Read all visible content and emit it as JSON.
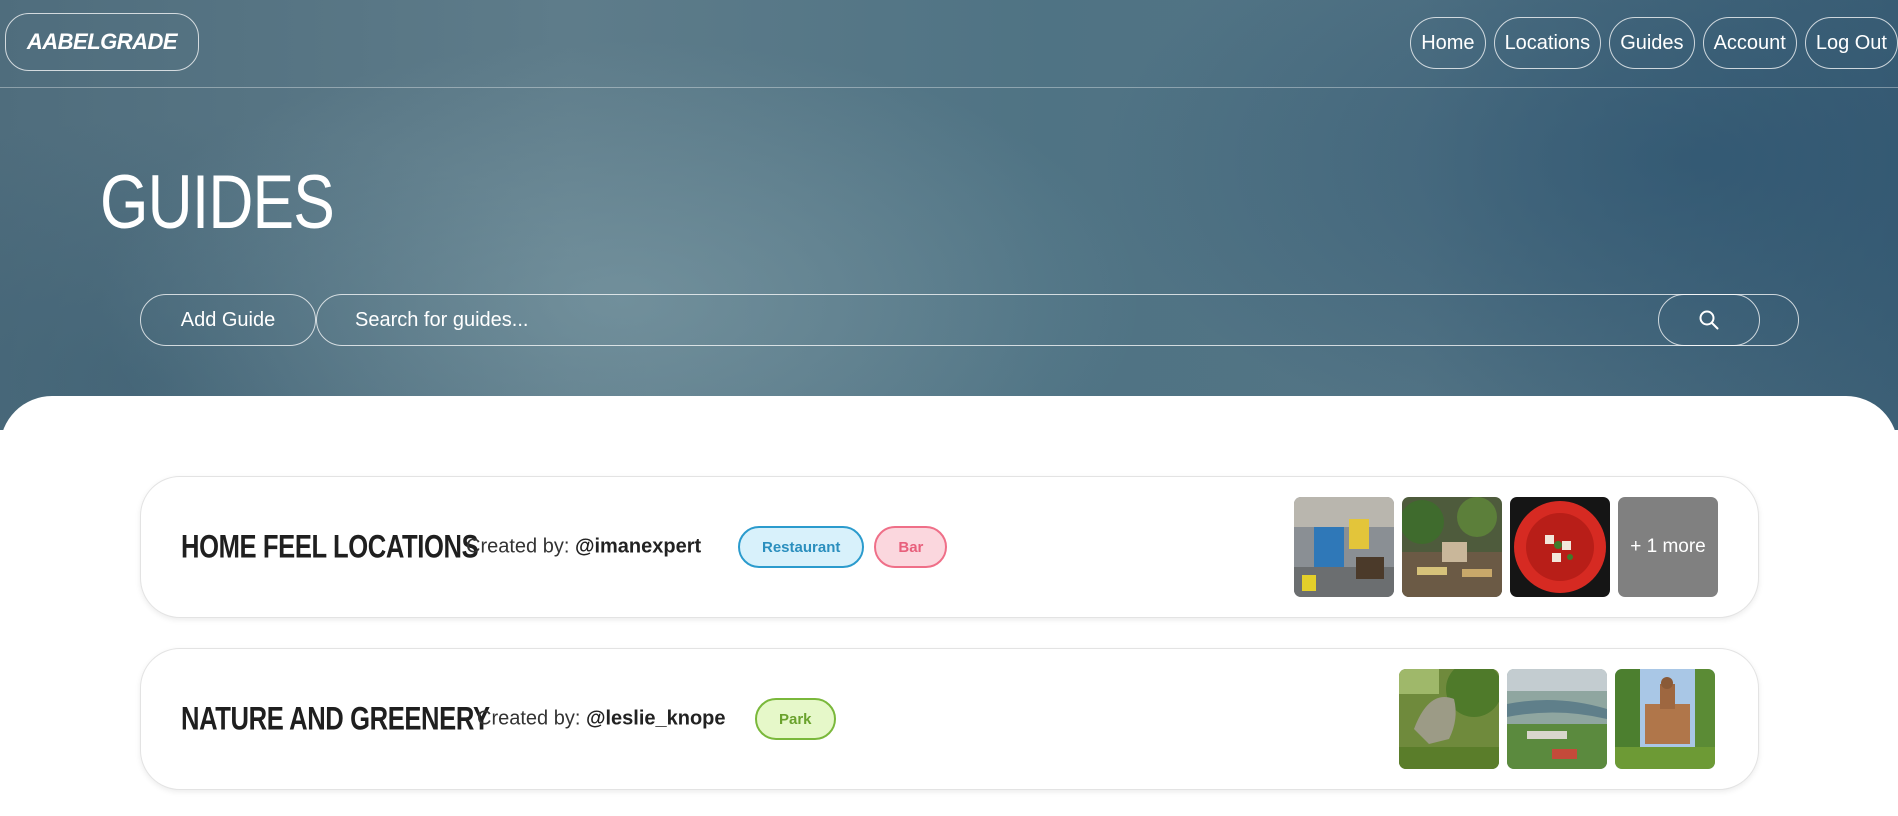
{
  "app": {
    "logo": "AABELGRADE"
  },
  "nav": {
    "items": [
      "Home",
      "Locations",
      "Guides",
      "Account",
      "Log Out"
    ]
  },
  "page": {
    "title": "GUIDES"
  },
  "toolbar": {
    "add_guide_label": "Add Guide",
    "search_placeholder": "Search for guides..."
  },
  "guides": [
    {
      "title": "HOME FEEL LOCATIONS",
      "created_by_label": "Created by:",
      "author": "@imanexpert",
      "tags": [
        {
          "label": "Restaurant",
          "bg": "#d8f1fb",
          "border": "#2b9bcd",
          "color": "#2b8fbe"
        },
        {
          "label": "Bar",
          "bg": "#fbd7de",
          "border": "#ef6f88",
          "color": "#e8607c"
        }
      ],
      "thumbnails": [
        "restaurant-interior-photo",
        "terrace-dining-photo",
        "red-dish-photo"
      ],
      "more_label": "+ 1 more"
    },
    {
      "title": "NATURE AND GREENERY",
      "created_by_label": "Created by:",
      "author": "@leslie_knope",
      "tags": [
        {
          "label": "Park",
          "bg": "#e6f8c9",
          "border": "#7ab83b",
          "color": "#6aa22c"
        }
      ],
      "thumbnails": [
        "dinosaur-sculpture-photo",
        "river-aerial-photo",
        "church-park-photo"
      ]
    }
  ],
  "colors": {
    "hero_blue": "#4f7384",
    "card_border": "#e3e3e3",
    "more_tile": "#808080"
  }
}
